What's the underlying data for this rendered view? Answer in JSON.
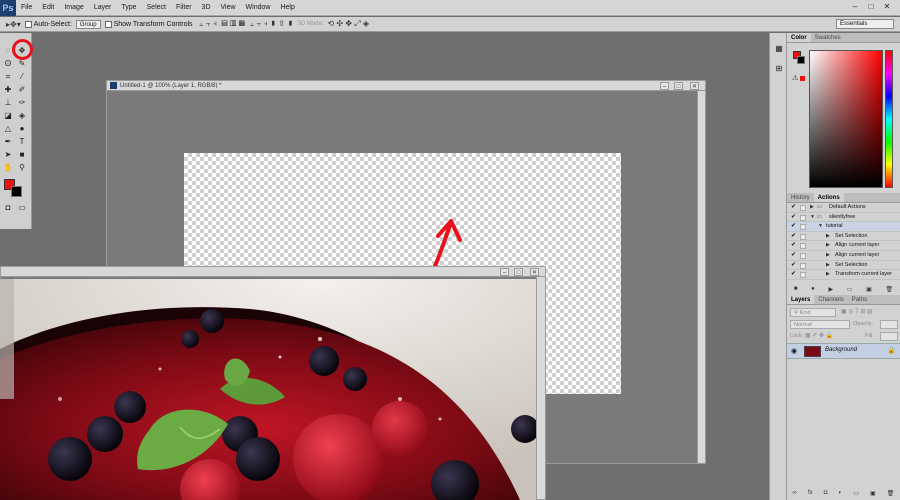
{
  "menubar": {
    "logo": "Ps",
    "items": [
      "File",
      "Edit",
      "Image",
      "Layer",
      "Type",
      "Select",
      "Filter",
      "3D",
      "View",
      "Window",
      "Help"
    ],
    "controls": [
      "–",
      "□",
      "✕"
    ]
  },
  "options": {
    "auto_select_label": "Auto-Select:",
    "auto_select_value": "Group",
    "show_transform_label": "Show Transform Controls",
    "mode_3d_label": "3D Mode:",
    "workspace": "Essentials"
  },
  "colors": {
    "foreground": "#f01010",
    "background": "#000000",
    "annotation": "#e8101a"
  },
  "document": {
    "title": "Untitled-1 @ 100% (Layer 1, RGB/8) *"
  },
  "panels": {
    "color_tabs": [
      "Color",
      "Swatches"
    ],
    "actions_tabs": [
      "History",
      "Actions"
    ],
    "actions": [
      {
        "label": "Default Actions",
        "type": "set",
        "checked": true
      },
      {
        "label": "silentlyfree",
        "type": "set",
        "checked": true
      },
      {
        "label": "tutorial",
        "type": "action",
        "checked": true
      },
      {
        "label": "Set Selection",
        "type": "step",
        "checked": true
      },
      {
        "label": "Align current layer",
        "type": "step",
        "checked": true
      },
      {
        "label": "Align current layer",
        "type": "step",
        "checked": true
      },
      {
        "label": "Set Selection",
        "type": "step",
        "checked": true
      },
      {
        "label": "Transform current layer",
        "type": "step",
        "checked": true
      }
    ],
    "layers_tabs": [
      "Layers",
      "Channels",
      "Paths"
    ],
    "kind_filter": "Kind",
    "blend_mode": "Normal",
    "opacity_label": "Opacity:",
    "lock_label": "Lock:",
    "fill_label": "Fill:",
    "layer_name": "Background"
  },
  "icons": [
    "marquee-icon",
    "move-icon",
    "lasso-icon",
    "brush-icon",
    "crop-icon",
    "eyedropper-icon",
    "stamp-icon",
    "eraser-icon",
    "pen-icon",
    "type-icon",
    "hand-icon",
    "zoom-icon",
    "eye-icon",
    "lock-icon"
  ]
}
